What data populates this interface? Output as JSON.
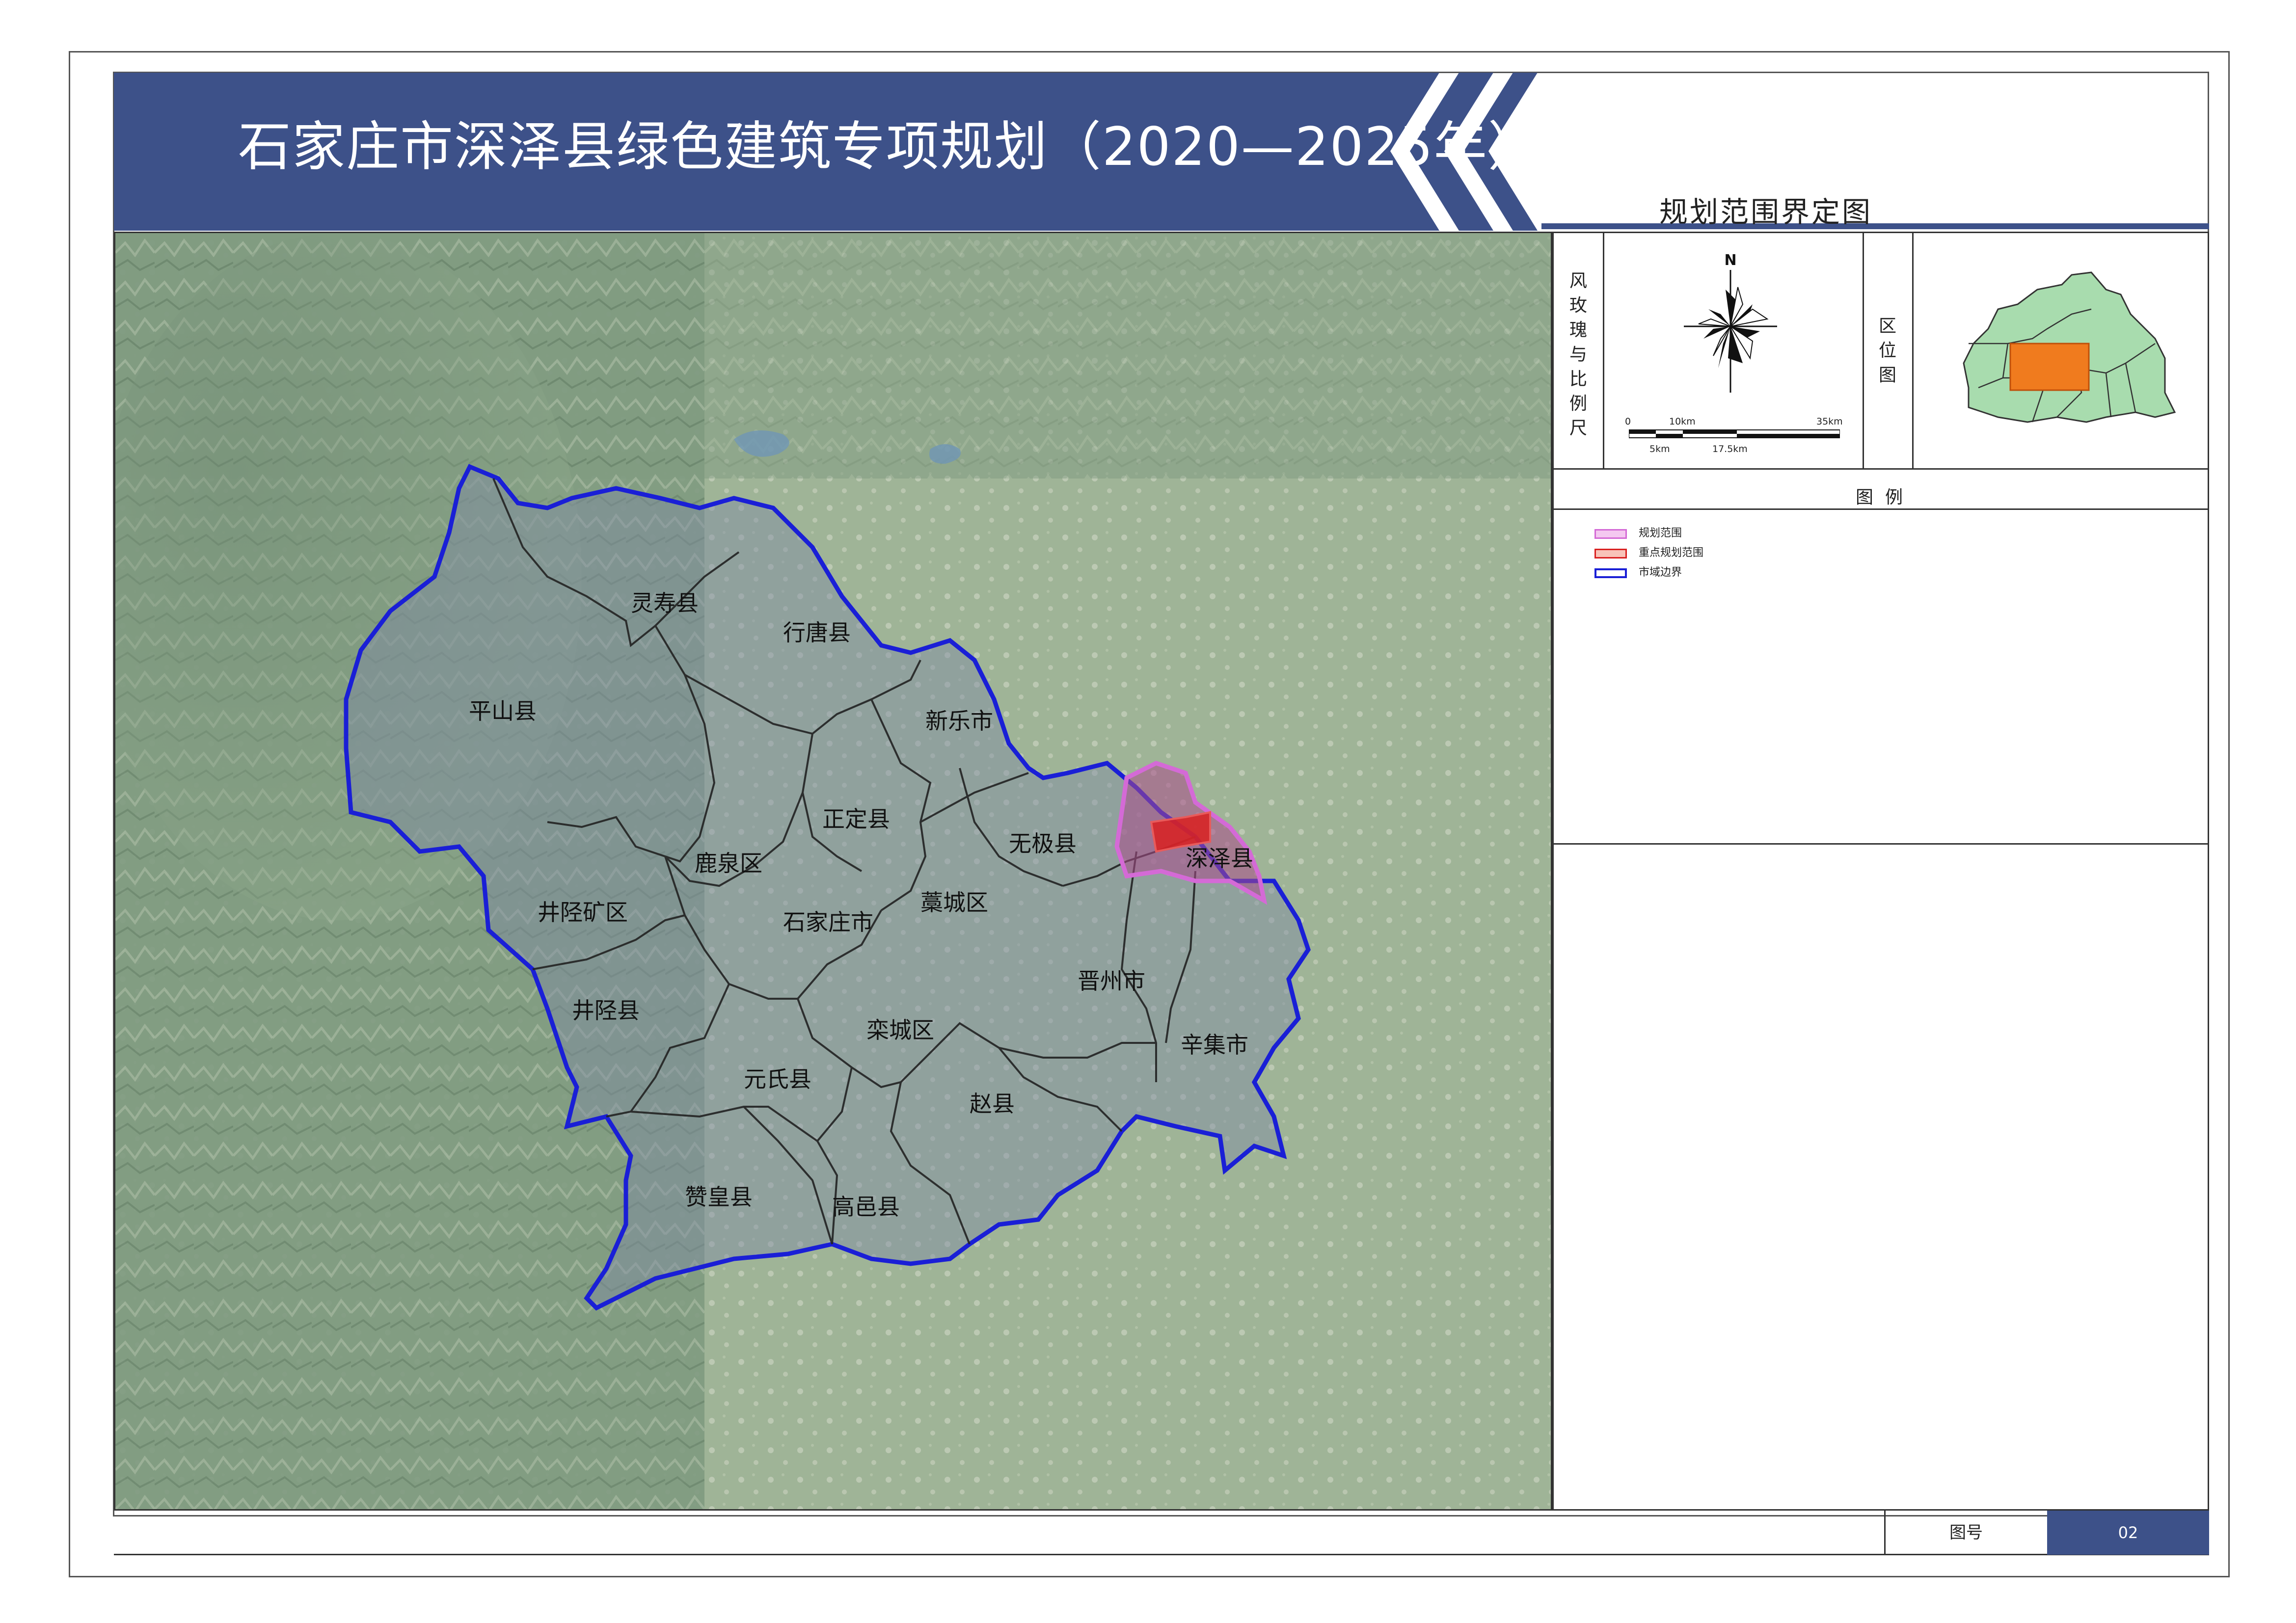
{
  "header": {
    "title": "石家庄市深泽县绿色建筑专项规划（2020—2025年）",
    "subtitle": "规划范围界定图",
    "banner_color": "#3d5189"
  },
  "compass": {
    "section_label": "风玫瑰与比例尺",
    "north_label": "N",
    "scale_top": [
      "0",
      "10km",
      "35km"
    ],
    "scale_bottom": [
      "5km",
      "17.5km"
    ]
  },
  "location_map": {
    "section_label": "区位图",
    "region_color": "#a8dcae",
    "highlight_color": "#f07b1e"
  },
  "legend": {
    "title": "图例",
    "items": [
      {
        "label": "规划范围",
        "color": "#d46ad6"
      },
      {
        "label": "重点规划范围",
        "color": "#d92020"
      },
      {
        "label": "市域边界",
        "color": "#1a1fd6"
      }
    ]
  },
  "map": {
    "districts": [
      "灵寿县",
      "行唐县",
      "平山县",
      "新乐市",
      "正定县",
      "无极县",
      "深泽县",
      "鹿泉区",
      "井陉矿区",
      "石家庄市",
      "藁城区",
      "晋州市",
      "井陉县",
      "栾城区",
      "辛集市",
      "元氏县",
      "赵县",
      "赞皇县",
      "高邑县"
    ],
    "boundary_color": "#1a1fd6",
    "planning_area_color": "#d46ad6",
    "key_area_color": "#d92020"
  },
  "footer": {
    "figure_label": "图号",
    "figure_number": "02",
    "box_color": "#3d5189"
  }
}
